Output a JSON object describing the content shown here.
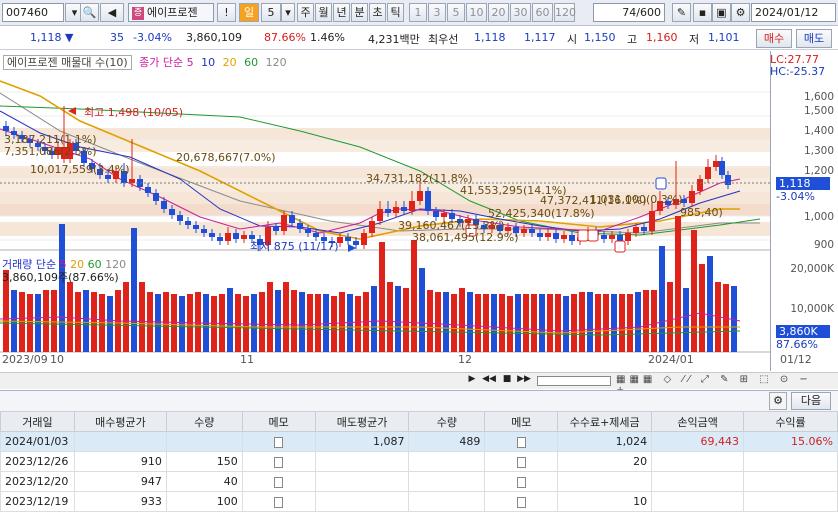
{
  "toolbar": {
    "code": "007460",
    "name": "에이프로젠",
    "period_label": "일",
    "period_value": "5",
    "periods": [
      "주",
      "월",
      "년",
      "분",
      "초",
      "틱"
    ],
    "numbers": [
      "1",
      "3",
      "5",
      "10",
      "20",
      "30",
      "60",
      "120"
    ],
    "count": "74",
    "count_total": "/600",
    "date": "2024/01/12"
  },
  "quote": {
    "price": "1,118",
    "arrow": "▼",
    "change": "35",
    "change_pct": "-3.04%",
    "volume": "3,860,109",
    "vol_ratio": "87.66%",
    "turnover": "1.46%",
    "amount": "4,231백만",
    "best_label": "최우선",
    "best_ask": "1,118",
    "best_bid": "1,117",
    "open_label": "시",
    "open": "1,150",
    "high_label": "고",
    "high": "1,160",
    "low_label": "저",
    "low": "1,101",
    "buy_label": "매수",
    "sell_label": "매도"
  },
  "chart": {
    "legend_name": "에이프로젠 매물대 수(10)",
    "legend_ma": "종가 단순",
    "legend_periods": [
      "5",
      "10",
      "20",
      "60",
      "120"
    ],
    "volume_legend": "거래량 단순",
    "volume_value": "3,860,109주(87.66%)",
    "lc": "LC:27.77",
    "hc": "HC:-25.37",
    "price_ticks": [
      "1,600",
      "1,500",
      "1,400",
      "1,300",
      "1,200",
      "1,000",
      "900"
    ],
    "current_price": "1,118",
    "current_pct": "-3.04%",
    "volume_ticks": [
      "20,000K",
      "10,000K"
    ],
    "vol_current": "3,860K",
    "vol_current_pct": "87.66%",
    "x_labels": [
      "2023/09",
      "10",
      "11",
      "12",
      "2024/01",
      "01/12"
    ],
    "high_label": "최고 1,498 (10/05)",
    "low_label": "최저 875 (11/17)",
    "profile_labels": [
      "3,187,211(1.1%)",
      "7,351,086(2.5%)",
      "10,017,559(3.4%)",
      "20,678,667(7.0%)",
      "34,731,182(11.8%)",
      "41,553,295(14.1%)",
      "47,372,411(16.1%)",
      "52,425,340(17.8%)",
      "39,160,467(13.3%)",
      "38,061,495(12.9%)",
      "1,031,000(0.3%)",
      "985,40)"
    ],
    "colors": {
      "up": "#e0231a",
      "down": "#1f4fd6",
      "ma5": "#cc1c9b",
      "ma10": "#2230c8",
      "ma20": "#e0a000",
      "ma60": "#1f9a30",
      "ma120": "#8a8a8a"
    }
  },
  "panel": {
    "next_label": "다음",
    "columns": [
      "거래일",
      "매수평균가",
      "수량",
      "메모",
      "매도평균가",
      "수량",
      "메모",
      "수수료+제세금",
      "손익금액",
      "수익률"
    ],
    "rows": [
      [
        "2024/01/03",
        "",
        "",
        "",
        "1,087",
        "489",
        "",
        "1,024",
        "69,443",
        "15.06%"
      ],
      [
        "2023/12/26",
        "910",
        "150",
        "",
        "",
        "",
        "",
        "20",
        "",
        ""
      ],
      [
        "2023/12/20",
        "947",
        "40",
        "",
        "",
        "",
        "",
        "",
        "",
        ""
      ],
      [
        "2023/12/19",
        "933",
        "100",
        "",
        "",
        "",
        "",
        "10",
        "",
        ""
      ]
    ]
  }
}
